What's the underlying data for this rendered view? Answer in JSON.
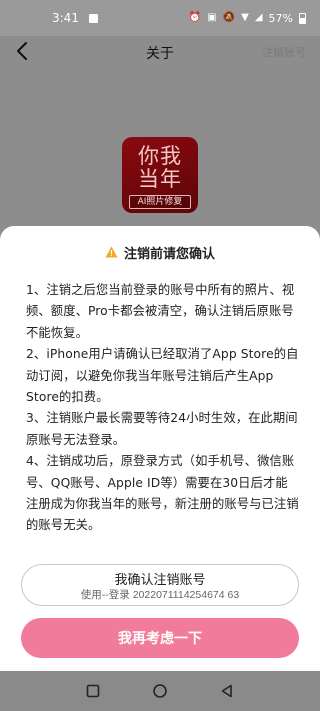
{
  "status_bar": {
    "time": "3:41",
    "battery": "57%",
    "icons": [
      "gallery-icon",
      "alarm-icon",
      "nfc-icon",
      "mute-icon",
      "wifi-icon",
      "signal-icon",
      "battery-icon"
    ]
  },
  "nav": {
    "title": "关于",
    "action": "注销账号",
    "back_icon": "back-chevron-icon"
  },
  "app_logo": {
    "line1": "你我",
    "line2": "当年",
    "tag": "AI照片修复"
  },
  "dialog": {
    "title": "注销前请您确认",
    "icon": "warning-icon",
    "paragraphs": [
      "1、注销之后您当前登录的账号中所有的照片、视频、额度、Pro卡都会被清空，确认注销后原账号不能恢复。",
      "2、iPhone用户请确认已经取消了App Store的自动订阅，以避免你我当年账号注销后产生App Store的扣费。",
      "3、注销账户最长需要等待24小时生效，在此期间原账号无法登录。",
      "4、注销成功后，原登录方式（如手机号、微信账号、QQ账号、Apple ID等）需要在30日后才能注册成为你我当年的账号，新注册的账号与已注销的账号无关。"
    ],
    "confirm_label": "我确认注销账号",
    "confirm_sub": "使用--登录 2022071114254674 63",
    "reconsider_label": "我再考虑一下"
  },
  "system_nav": [
    "recent-apps-icon",
    "home-icon",
    "back-icon"
  ],
  "colors": {
    "accent": "#f17b9a",
    "overlay": "#8d8d8d",
    "warning": "#f5a623"
  }
}
